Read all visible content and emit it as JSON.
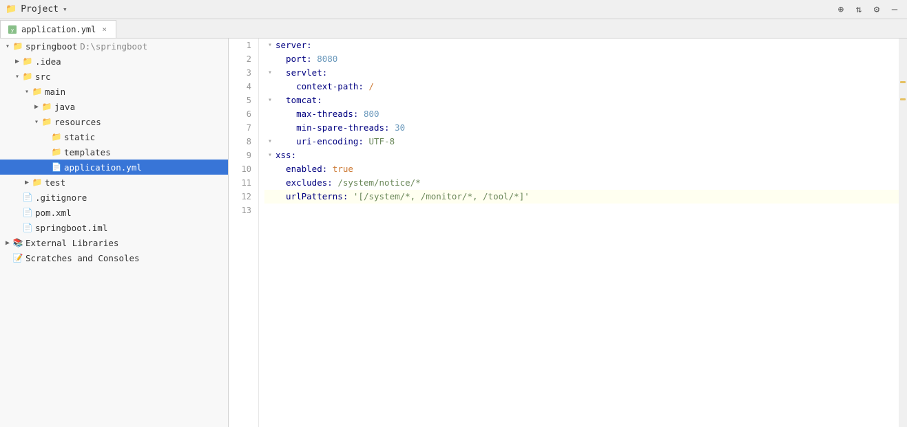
{
  "toolbar": {
    "title": "Project",
    "chevron": "▾",
    "buttons": [
      "+",
      "≡",
      "⚙",
      "—"
    ]
  },
  "tab": {
    "filename": "application.yml",
    "icon_color": "#6aaf6a",
    "close": "×"
  },
  "sidebar": {
    "items": [
      {
        "id": "springboot-root",
        "label": "springboot",
        "path": "D:\\springboot",
        "indent": 0,
        "arrow": "▾",
        "icon": "project",
        "selected": false
      },
      {
        "id": "idea",
        "label": ".idea",
        "indent": 1,
        "arrow": "▶",
        "icon": "folder",
        "selected": false
      },
      {
        "id": "src",
        "label": "src",
        "indent": 1,
        "arrow": "▾",
        "icon": "folder",
        "selected": false
      },
      {
        "id": "main",
        "label": "main",
        "indent": 2,
        "arrow": "▾",
        "icon": "folder",
        "selected": false
      },
      {
        "id": "java",
        "label": "java",
        "indent": 3,
        "arrow": "▶",
        "icon": "folder-blue",
        "selected": false
      },
      {
        "id": "resources",
        "label": "resources",
        "indent": 3,
        "arrow": "▾",
        "icon": "folder-res",
        "selected": false
      },
      {
        "id": "static",
        "label": "static",
        "indent": 4,
        "arrow": "",
        "icon": "folder",
        "selected": false
      },
      {
        "id": "templates",
        "label": "templates",
        "indent": 4,
        "arrow": "",
        "icon": "folder",
        "selected": false
      },
      {
        "id": "application-yml",
        "label": "application.yml",
        "indent": 4,
        "arrow": "",
        "icon": "yaml",
        "selected": true
      },
      {
        "id": "test",
        "label": "test",
        "indent": 2,
        "arrow": "▶",
        "icon": "folder",
        "selected": false
      },
      {
        "id": "gitignore",
        "label": ".gitignore",
        "indent": 1,
        "arrow": "",
        "icon": "gitignore",
        "selected": false
      },
      {
        "id": "pom-xml",
        "label": "pom.xml",
        "indent": 1,
        "arrow": "",
        "icon": "xml",
        "selected": false
      },
      {
        "id": "springboot-iml",
        "label": "springboot.iml",
        "indent": 1,
        "arrow": "",
        "icon": "iml",
        "selected": false
      },
      {
        "id": "external-libraries",
        "label": "External Libraries",
        "indent": 0,
        "arrow": "▶",
        "icon": "lib",
        "selected": false
      },
      {
        "id": "scratches",
        "label": "Scratches and Consoles",
        "indent": 0,
        "arrow": "",
        "icon": "scratch",
        "selected": false
      }
    ]
  },
  "editor": {
    "lines": [
      {
        "num": 1,
        "fold": "▾",
        "indent": 0,
        "content": [
          {
            "type": "key",
            "text": "server:"
          }
        ]
      },
      {
        "num": 2,
        "fold": "",
        "indent": 2,
        "content": [
          {
            "type": "key",
            "text": "  port: "
          },
          {
            "type": "val-num",
            "text": "8080"
          }
        ]
      },
      {
        "num": 3,
        "fold": "▾",
        "indent": 2,
        "content": [
          {
            "type": "key",
            "text": "  servlet:"
          }
        ]
      },
      {
        "num": 4,
        "fold": "",
        "indent": 4,
        "content": [
          {
            "type": "key",
            "text": "    context-path: "
          },
          {
            "type": "val-path",
            "text": "/"
          }
        ]
      },
      {
        "num": 5,
        "fold": "▾",
        "indent": 2,
        "content": [
          {
            "type": "key",
            "text": "  tomcat:"
          }
        ]
      },
      {
        "num": 6,
        "fold": "",
        "indent": 4,
        "content": [
          {
            "type": "key",
            "text": "    max-threads: "
          },
          {
            "type": "val-num",
            "text": "800"
          }
        ]
      },
      {
        "num": 7,
        "fold": "",
        "indent": 4,
        "content": [
          {
            "type": "key",
            "text": "    min-spare-threads: "
          },
          {
            "type": "val-num",
            "text": "30"
          }
        ]
      },
      {
        "num": 8,
        "fold": "▾",
        "indent": 4,
        "content": [
          {
            "type": "key",
            "text": "    uri-encoding: "
          },
          {
            "type": "val-str",
            "text": "UTF-8"
          }
        ]
      },
      {
        "num": 9,
        "fold": "▾",
        "indent": 0,
        "content": [
          {
            "type": "key",
            "text": "xss:"
          }
        ]
      },
      {
        "num": 10,
        "fold": "",
        "indent": 2,
        "content": [
          {
            "type": "key",
            "text": "  enabled: "
          },
          {
            "type": "val-bool",
            "text": "true"
          }
        ]
      },
      {
        "num": 11,
        "fold": "",
        "indent": 2,
        "content": [
          {
            "type": "key",
            "text": "  excludes: "
          },
          {
            "type": "val-str",
            "text": "/system/notice/*"
          }
        ]
      },
      {
        "num": 12,
        "fold": "",
        "indent": 2,
        "content": [
          {
            "type": "key",
            "text": "  urlPatterns: "
          },
          {
            "type": "val-str",
            "text": "'[/system/*, /monitor/*, /tool/*]'"
          }
        ],
        "highlighted": true
      },
      {
        "num": 13,
        "fold": "",
        "indent": 0,
        "content": []
      }
    ]
  },
  "gutter_marks": [
    {
      "pos": "30%"
    },
    {
      "pos": "50%"
    }
  ]
}
